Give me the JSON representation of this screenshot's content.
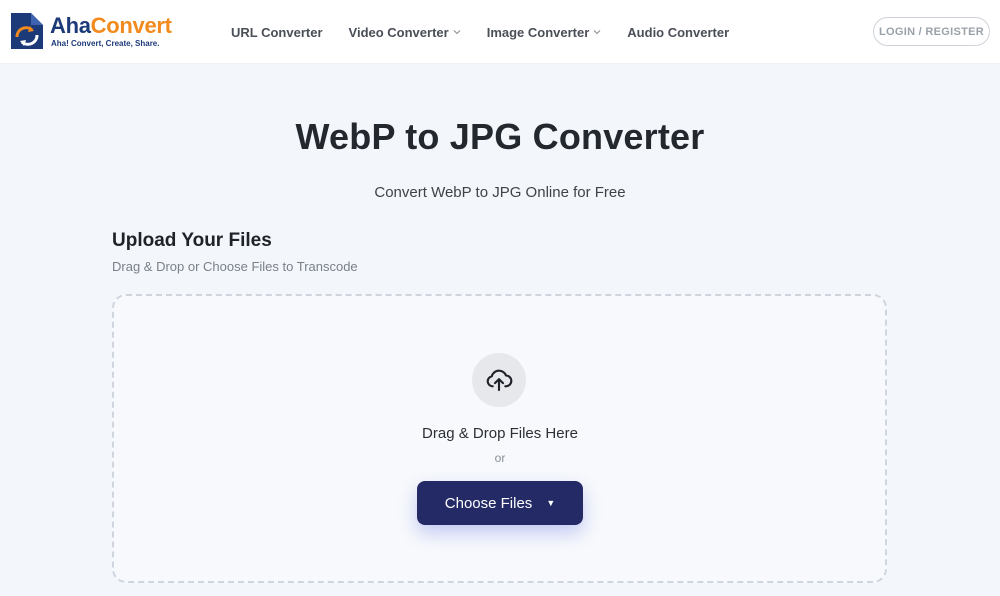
{
  "header": {
    "logo": {
      "brand_part1": "Aha",
      "brand_part2": "Convert",
      "tagline": "Aha! Convert, Create, Share."
    },
    "nav": [
      {
        "label": "URL Converter",
        "has_dropdown": false
      },
      {
        "label": "Video Converter",
        "has_dropdown": true
      },
      {
        "label": "Image Converter",
        "has_dropdown": true
      },
      {
        "label": "Audio Converter",
        "has_dropdown": false
      }
    ],
    "login_label": "LOGIN / REGISTER"
  },
  "hero": {
    "title": "WebP to JPG Converter",
    "subtitle": "Convert WebP to JPG Online for Free"
  },
  "upload": {
    "heading": "Upload Your Files",
    "subheading": "Drag & Drop or Choose Files to Transcode",
    "drop_text": "Drag & Drop Files Here",
    "or_text": "or",
    "choose_button": "Choose Files",
    "icon": "cloud-upload-icon"
  },
  "colors": {
    "brand_navy": "#1d3a78",
    "brand_orange": "#f28a1d",
    "button_bg": "#242a66",
    "page_bg": "#f3f6fb"
  }
}
